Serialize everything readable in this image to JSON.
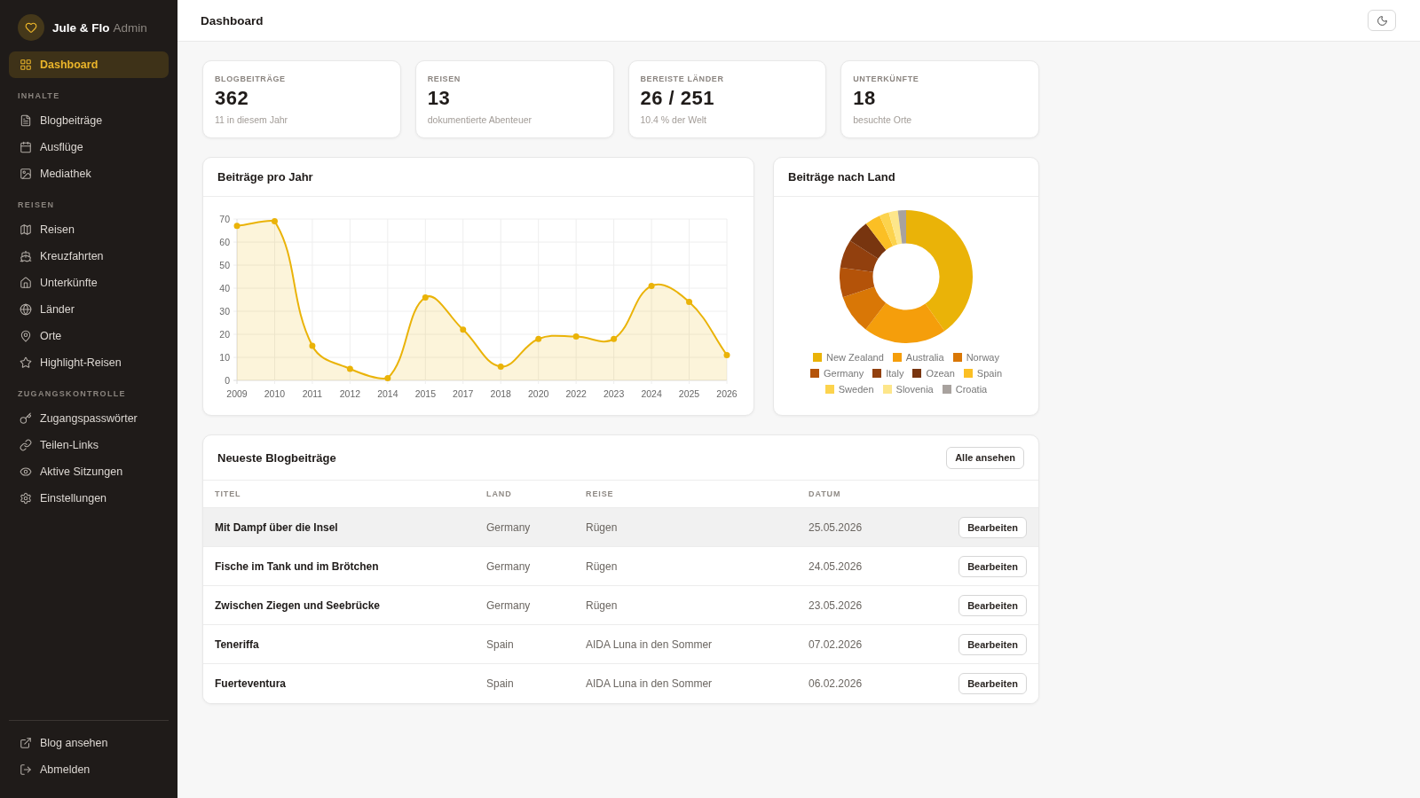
{
  "sidebar": {
    "brand": {
      "name": "Jule & Flo",
      "role": "Admin"
    },
    "nav": [
      {
        "label": "Dashboard",
        "selected": true
      }
    ],
    "sections": [
      {
        "title": "INHALTE",
        "items": [
          {
            "label": "Blogbeiträge",
            "selected": false
          },
          {
            "label": "Ausflüge",
            "selected": false
          },
          {
            "label": "Mediathek",
            "selected": false
          }
        ]
      },
      {
        "title": "REISEN",
        "items": [
          {
            "label": "Reisen",
            "selected": false
          },
          {
            "label": "Kreuzfahrten",
            "selected": false
          },
          {
            "label": "Unterkünfte",
            "selected": false
          },
          {
            "label": "Länder",
            "selected": false
          },
          {
            "label": "Orte",
            "selected": false
          },
          {
            "label": "Highlight-Reisen",
            "selected": false
          }
        ]
      },
      {
        "title": "ZUGANGSKONTROLLE",
        "items": [
          {
            "label": "Zugangspasswörter",
            "selected": false
          },
          {
            "label": "Teilen-Links",
            "selected": false
          },
          {
            "label": "Aktive Sitzungen",
            "selected": false
          },
          {
            "label": "Einstellungen",
            "selected": false
          }
        ]
      }
    ],
    "footer": [
      {
        "label": "Blog ansehen"
      },
      {
        "label": "Abmelden"
      }
    ]
  },
  "header": {
    "title": "Dashboard"
  },
  "stats": [
    {
      "label": "BLOGBEITRÄGE",
      "value": "362",
      "note": "11 in diesem Jahr"
    },
    {
      "label": "REISEN",
      "value": "13",
      "note": "dokumentierte Abenteuer"
    },
    {
      "label": "BEREISTE LÄNDER",
      "value": "26 / 251",
      "note": "10.4 % der Welt"
    },
    {
      "label": "UNTERKÜNFTE",
      "value": "18",
      "note": "besuchte Orte"
    }
  ],
  "posts_per_year": {
    "title": "Beiträge pro Jahr",
    "chart_data": {
      "type": "area",
      "categories": [
        "2009",
        "2010",
        "2011",
        "2012",
        "2014",
        "2015",
        "2017",
        "2018",
        "2020",
        "2022",
        "2023",
        "2024",
        "2025",
        "2026"
      ],
      "series": [
        {
          "color": "#eab308",
          "values": [
            67,
            69,
            15,
            5,
            1,
            36,
            22,
            6,
            18,
            19,
            18,
            41,
            34,
            11
          ]
        }
      ],
      "ylim": [
        0,
        70
      ],
      "yticks": [
        0,
        10,
        20,
        30,
        40,
        50,
        60,
        70
      ],
      "grid": true
    }
  },
  "posts_by_country": {
    "title": "Beiträge nach Land",
    "chart_data": {
      "type": "donut",
      "categories": [
        "New Zealand",
        "Australia",
        "Norway",
        "Germany",
        "Italy",
        "Ozean",
        "Spain",
        "Sweden",
        "Slovenia",
        "Croatia"
      ],
      "values": [
        40.2,
        20.2,
        9.6,
        7.2,
        6.9,
        5.6,
        3.8,
        2.3,
        2.2,
        2.0
      ],
      "colors": [
        "#eab308",
        "#f59e0b",
        "#d97706",
        "#b45309",
        "#92400e",
        "#78350f",
        "#fbbf24",
        "#fcd34d",
        "#fde68a",
        "#a8a29e"
      ],
      "legend": "bottom"
    }
  },
  "latest_posts": {
    "title": "Neueste Blogbeiträge",
    "action": "Alle ansehen",
    "columns": [
      "TITEL",
      "LAND",
      "REISE",
      "DATUM"
    ],
    "rows": [
      {
        "title": "Mit Dampf über die Insel",
        "country": "Germany",
        "trip": "Rügen",
        "date": "25.05.2026",
        "action": "Bearbeiten",
        "highlighted": true
      },
      {
        "title": "Fische im Tank und im Brötchen",
        "country": "Germany",
        "trip": "Rügen",
        "date": "24.05.2026",
        "action": "Bearbeiten",
        "highlighted": false
      },
      {
        "title": "Zwischen Ziegen und Seebrücke",
        "country": "Germany",
        "trip": "Rügen",
        "date": "23.05.2026",
        "action": "Bearbeiten",
        "highlighted": false
      },
      {
        "title": "Teneriffa",
        "country": "Spain",
        "trip": "AIDA Luna in den Sommer",
        "date": "07.02.2026",
        "action": "Bearbeiten",
        "highlighted": false
      },
      {
        "title": "Fuerteventura",
        "country": "Spain",
        "trip": "AIDA Luna in den Sommer",
        "date": "06.02.2026",
        "action": "Bearbeiten",
        "highlighted": false
      }
    ]
  }
}
